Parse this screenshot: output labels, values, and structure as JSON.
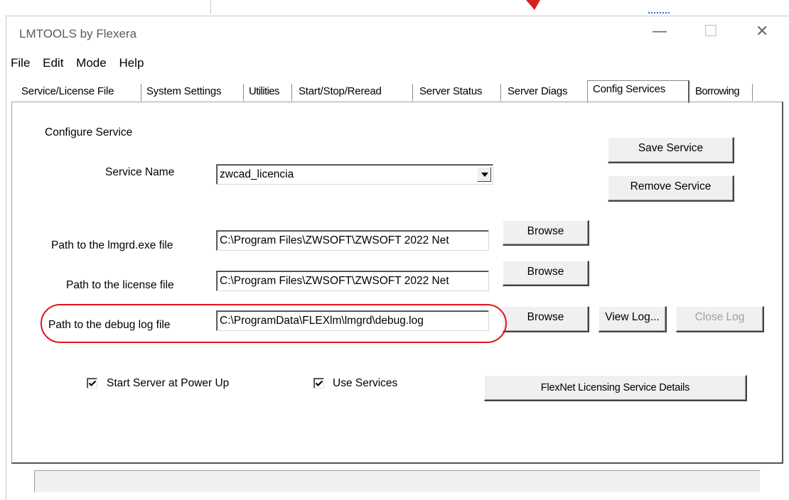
{
  "window": {
    "title": "LMTOOLS by Flexera",
    "controls": {
      "minimize": "—",
      "maximize": "☐",
      "close": "✕"
    }
  },
  "menu": [
    "File",
    "Edit",
    "Mode",
    "Help"
  ],
  "tabs": [
    "Service/License File",
    "System Settings",
    "Utilities",
    "Start/Stop/Reread",
    "Server Status",
    "Server Diags",
    "Config Services",
    "Borrowing"
  ],
  "active_tab": "Config Services",
  "config": {
    "section_label": "Configure Service",
    "service_name_label": "Service Name",
    "service_name_value": "zwcad_licencia",
    "lmgrd_label": "Path to the lmgrd.exe file",
    "lmgrd_value": "C:\\Program Files\\ZWSOFT\\ZWSOFT 2022 Net",
    "license_label": "Path to the license file",
    "license_value": "C:\\Program Files\\ZWSOFT\\ZWSOFT 2022 Net",
    "debug_label": "Path to the debug log file",
    "debug_value": "C:\\ProgramData\\FLEXlm\\lmgrd\\debug.log",
    "save_service": "Save Service",
    "remove_service": "Remove Service",
    "browse": "Browse",
    "view_log": "View Log...",
    "close_log": "Close Log",
    "start_at_power_up": "Start Server at Power Up",
    "use_services": "Use Services",
    "flexnet_details": "FlexNet Licensing Service Details"
  },
  "colors": {
    "highlight_ring": "#e0141e",
    "dialog_face": "#f0f0f0"
  }
}
